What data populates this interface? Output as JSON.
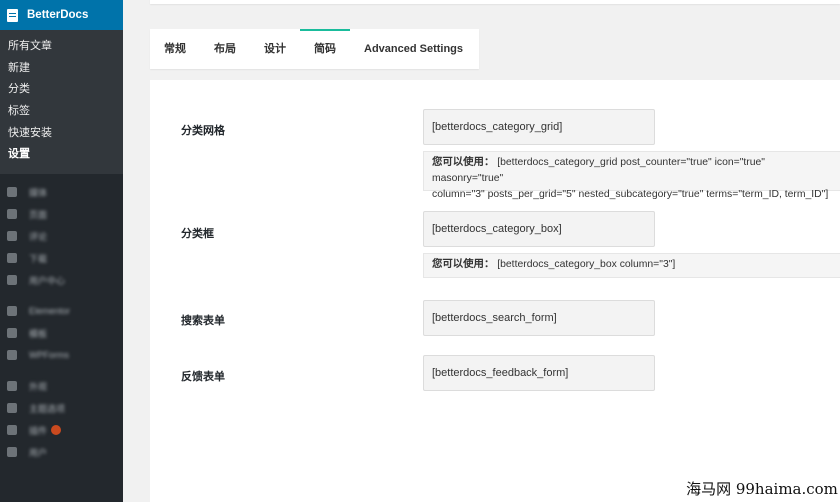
{
  "sidebar": {
    "plugin_title": "BetterDocs",
    "submenu": [
      {
        "label": "所有文章"
      },
      {
        "label": "新建"
      },
      {
        "label": "分类"
      },
      {
        "label": "标签"
      },
      {
        "label": "快速安装"
      },
      {
        "label": "设置"
      }
    ],
    "menu_blurred": [
      {
        "label": "媒体",
        "icon": "media-icon"
      },
      {
        "label": "页面",
        "icon": "pages-icon"
      },
      {
        "label": "评论",
        "icon": "comments-icon"
      },
      {
        "label": "下载",
        "icon": "download-icon"
      },
      {
        "label": "用户中心",
        "icon": "user-center-icon"
      },
      {
        "label": "Elementor",
        "icon": "elementor-icon"
      },
      {
        "label": "模板",
        "icon": "templates-icon"
      },
      {
        "label": "WPForms",
        "icon": "wpforms-icon"
      },
      {
        "label": "外观",
        "icon": "appearance-icon"
      },
      {
        "label": "主题选项",
        "icon": "theme-options-icon"
      },
      {
        "label": "插件",
        "icon": "plugins-icon"
      },
      {
        "label": "用户",
        "icon": "users-icon"
      }
    ]
  },
  "tabs": [
    {
      "label": "常规"
    },
    {
      "label": "布局"
    },
    {
      "label": "设计"
    },
    {
      "label": "简码"
    },
    {
      "label": "Advanced Settings"
    }
  ],
  "shortcodes": {
    "category_grid": {
      "label": "分类网格",
      "value": "[betterdocs_category_grid]",
      "usage_label": "您可以使用：",
      "usage_line1": "[betterdocs_category_grid post_counter=\"true\" icon=\"true\" masonry=\"true\"",
      "usage_line2": "column=\"3\" posts_per_grid=\"5\" nested_subcategory=\"true\" terms=\"term_ID, term_ID\"]"
    },
    "category_box": {
      "label": "分类框",
      "value": "[betterdocs_category_box]",
      "usage_label": "您可以使用：",
      "usage_line1": "[betterdocs_category_box column=\"3\"]"
    },
    "search_form": {
      "label": "搜索表单",
      "value": "[betterdocs_search_form]"
    },
    "feedback_form": {
      "label": "反馈表单",
      "value": "[betterdocs_feedback_form]"
    }
  },
  "watermark": "海马网 99haima.com",
  "colors": {
    "sidebar_bg": "#23282d",
    "submenu_bg": "#32373c",
    "plugin_head_bg": "#0073aa",
    "active_tab_accent": "#1abc9c"
  }
}
